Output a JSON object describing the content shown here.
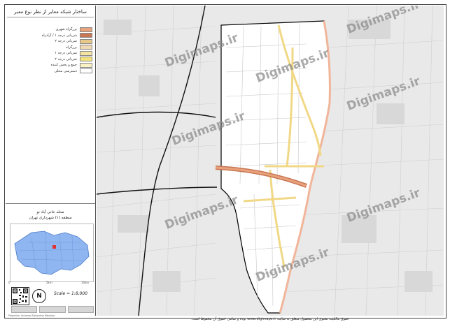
{
  "panel": {
    "title": "ساختار شبکه معابر از نظر نوع معبر",
    "legend": [
      {
        "label": "بزرگراه شهری",
        "color": "#e8a27c"
      },
      {
        "label": "شریانی درجه ۱ / آزادراه",
        "color": "#c87654"
      },
      {
        "label": "شریانی درجه ۲",
        "color": "#e7c78a"
      },
      {
        "label": "بزرگراه",
        "color": "#f0d9b5"
      },
      {
        "label": "شریانی درجه ۱",
        "color": "#f5e3a0"
      },
      {
        "label": "شریانی درجه ۲",
        "color": "#f2e37a"
      },
      {
        "label": "جمع و پخش کننده",
        "color": "#f9f2c4"
      },
      {
        "label": "دسترسی محلی",
        "color": "#ffffff"
      }
    ],
    "area_line1": "محله خانی آباد نو",
    "area_line2": "منطقه (۱) شهرداری تهران",
    "north_label": "N",
    "scale": "Scale = 1:8,000",
    "inset_axis": [
      "0",
      "5km",
      "10km"
    ],
    "credit": "Projection: Universal Transverse Mercator"
  },
  "map": {
    "watermark": "Digimaps.ir",
    "highlight_color": "#ffffff",
    "base_color": "#e9e9e9",
    "boundary_color": "#f1b59a"
  },
  "footer": {
    "text": "حقوق مالکیت معنوی این محصول متعلق به سایت www.digimaps.ir بوده و تمامی حقوق آن محفوظ است."
  }
}
